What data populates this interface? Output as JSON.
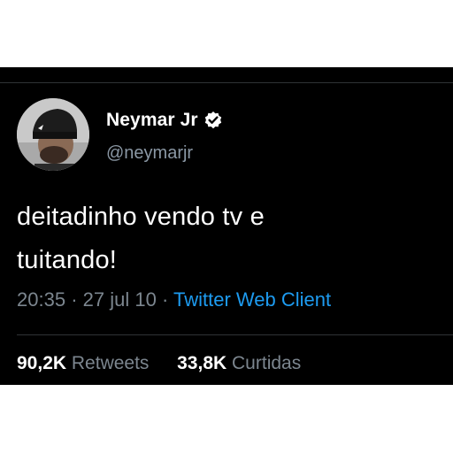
{
  "tweet": {
    "author": {
      "display_name": "Neymar Jr",
      "handle": "@neymarjr",
      "verified_icon": "verified-badge-icon"
    },
    "text_line1": "deitadinho vendo tv e",
    "text_line2": "tuitando!",
    "time": "20:35",
    "separator": "·",
    "date": "27 jul 10",
    "source": "Twitter Web Client",
    "stats": {
      "retweets_count": "90,2K",
      "retweets_label": "Retweets",
      "likes_count": "33,8K",
      "likes_label": "Curtidas"
    }
  },
  "colors": {
    "background": "#000000",
    "text": "#ffffff",
    "muted": "#7c868f",
    "link": "#1d9bf0"
  }
}
